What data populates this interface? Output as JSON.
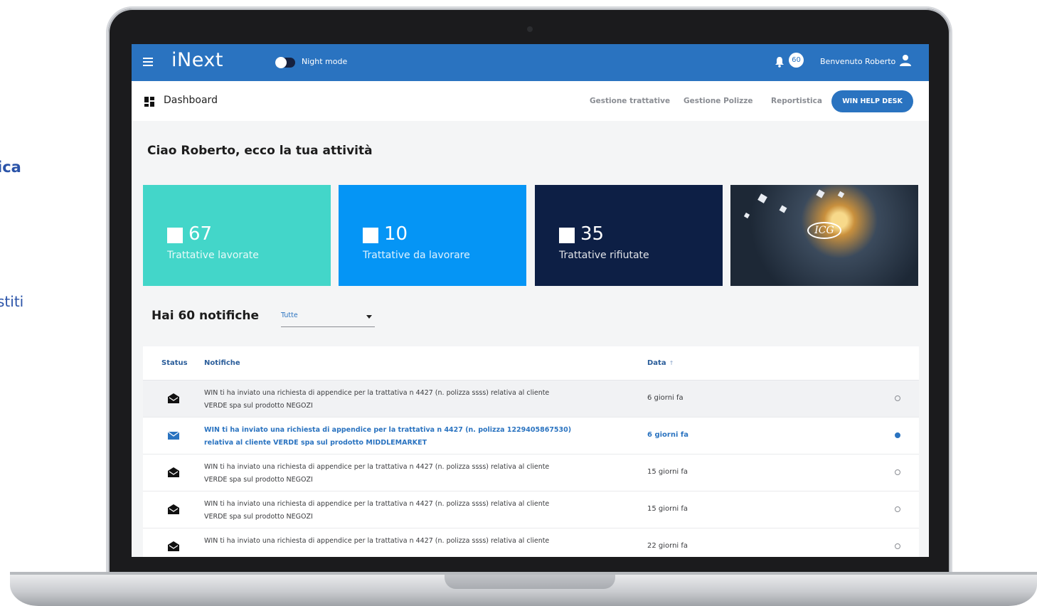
{
  "side_texts": {
    "a": "ica",
    "b": "stiti"
  },
  "topbar": {
    "brand": "iNext",
    "night_mode_label": "Night mode",
    "notification_count": "60",
    "welcome": "Benvenuto Roberto",
    "accent": "#2a73c0"
  },
  "subbar": {
    "title": "Dashboard",
    "nav": [
      "Gestione trattative",
      "Gestione Polizze",
      "Reportistica"
    ],
    "help_button": "WIN HELP DESK"
  },
  "greeting": "Ciao Roberto, ecco la tua attività",
  "cards": [
    {
      "value": "67",
      "label": "Trattative lavorate",
      "color": "#43d6c9"
    },
    {
      "value": "10",
      "label": "Trattative da lavorare",
      "color": "#0595f5"
    },
    {
      "value": "35",
      "label": "Trattative rifiutate",
      "color": "#0d1f45"
    }
  ],
  "photo_card": {
    "logo_text": "ICG"
  },
  "notifications": {
    "title": "Hai 60 notifiche",
    "filter_value": "Tutte",
    "columns": {
      "status": "Status",
      "notifications": "Notifiche",
      "date": "Data"
    },
    "rows": [
      {
        "text": "WIN ti ha inviato una richiesta di appendice per la trattativa n 4427 (n. polizza ssss) relativa al cliente VERDE spa sul prodotto NEGOZI",
        "date": "6 giorni fa",
        "unread": false
      },
      {
        "text": "WIN ti ha inviato una richiesta di appendice per la trattativa n 4427 (n. polizza 1229405867530) relativa al cliente VERDE spa sul prodotto MIDDLEMARKET",
        "date": "6 giorni fa",
        "unread": true
      },
      {
        "text": "WIN ti ha inviato una richiesta di appendice per la trattativa n 4427 (n. polizza ssss) relativa al cliente VERDE spa sul prodotto NEGOZI",
        "date": "15 giorni fa",
        "unread": false
      },
      {
        "text": "WIN ti ha inviato una richiesta di appendice per la trattativa n 4427 (n. polizza ssss) relativa al cliente VERDE spa sul prodotto NEGOZI",
        "date": "15 giorni fa",
        "unread": false
      },
      {
        "text": "WIN ti ha inviato una richiesta di appendice per la trattativa n 4427 (n. polizza ssss) relativa al cliente",
        "date": "22 giorni fa",
        "unread": false
      }
    ]
  }
}
